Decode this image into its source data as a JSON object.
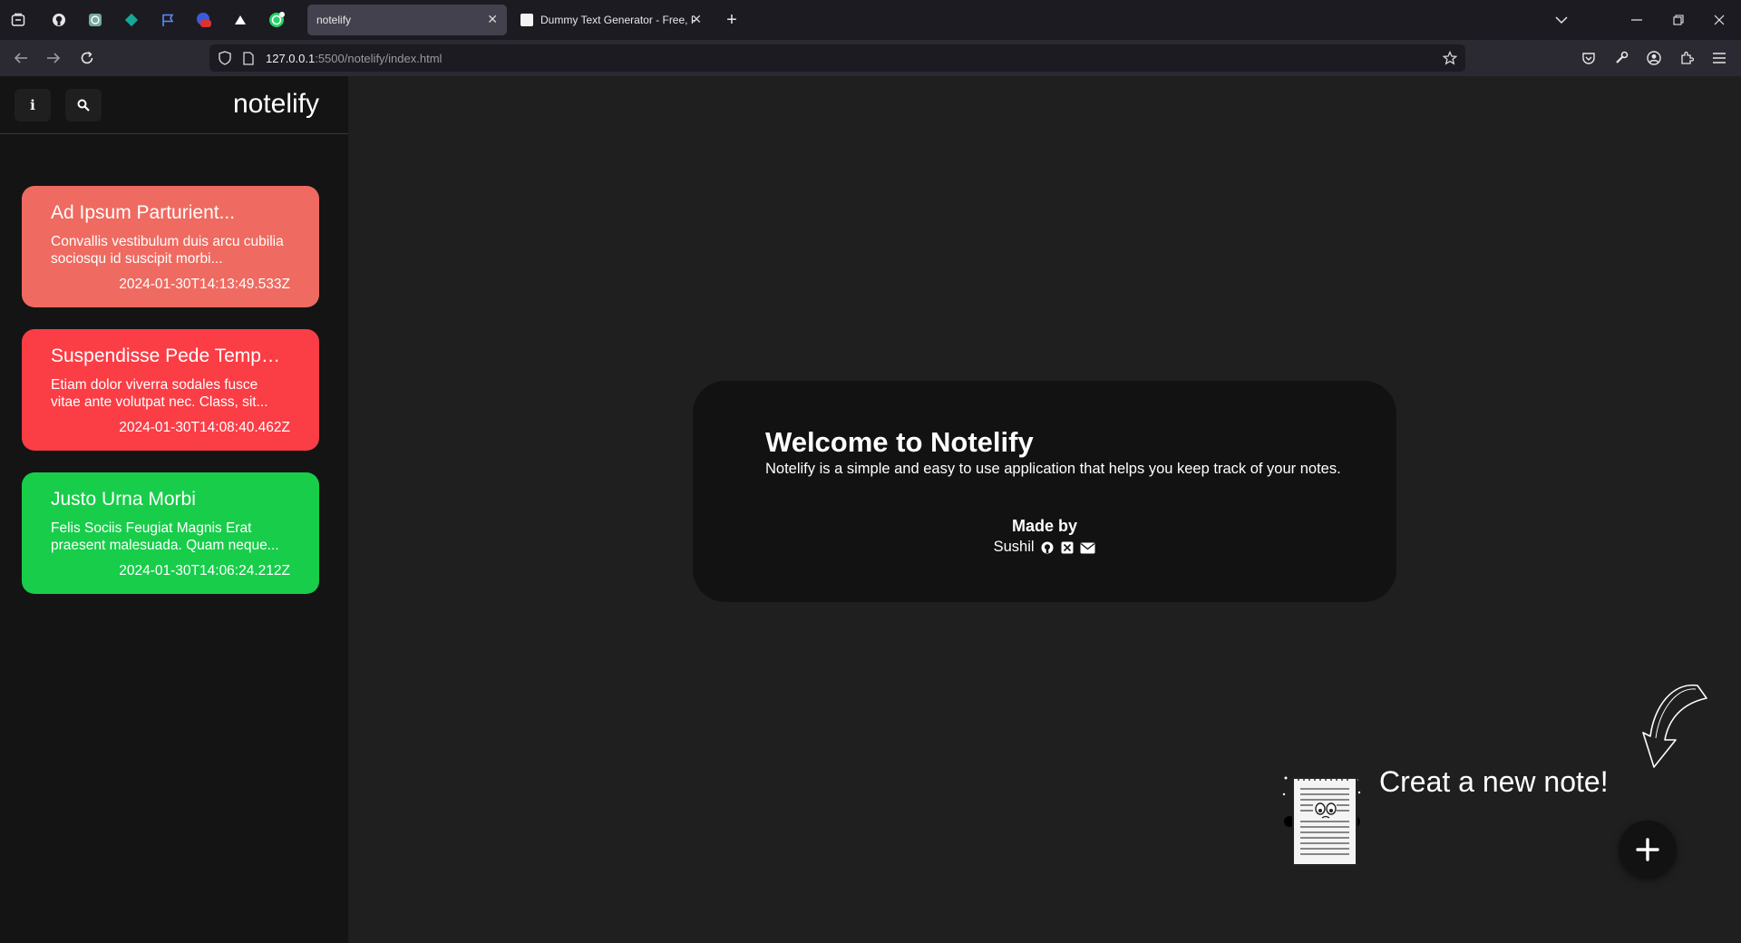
{
  "browser": {
    "tabs": [
      {
        "title": "notelify",
        "active": true
      },
      {
        "title": "Dummy Text Generator - Free, P",
        "active": false
      }
    ],
    "url_host": "127.0.0.1",
    "url_rest": ":5500/notelify/index.html"
  },
  "sidebar": {
    "info_label": "i",
    "brand": "notelify",
    "notes": [
      {
        "title": "Ad Ipsum Parturient...",
        "body": "Convallis vestibulum duis arcu cubilia sociosqu id suscipit morbi...",
        "date": "2024-01-30T14:13:49.533Z",
        "color": "#ef6a60"
      },
      {
        "title": "Suspendisse Pede Tempor...",
        "body": "Etiam dolor viverra sodales fusce vitae ante volutpat nec. Class, sit...",
        "date": "2024-01-30T14:08:40.462Z",
        "color": "#fb3d45"
      },
      {
        "title": "Justo Urna Morbi",
        "body": "Felis Sociis Feugiat Magnis Erat praesent malesuada. Quam neque...",
        "date": "2024-01-30T14:06:24.212Z",
        "color": "#18cd4a"
      }
    ]
  },
  "welcome": {
    "title": "Welcome to Notelify",
    "description": "Notelify is a simple and easy to use application that helps you keep track of your notes.",
    "made_by": "Made by",
    "author": "Sushil"
  },
  "cta": {
    "text": "Creat a new note!",
    "add_label": "+"
  }
}
